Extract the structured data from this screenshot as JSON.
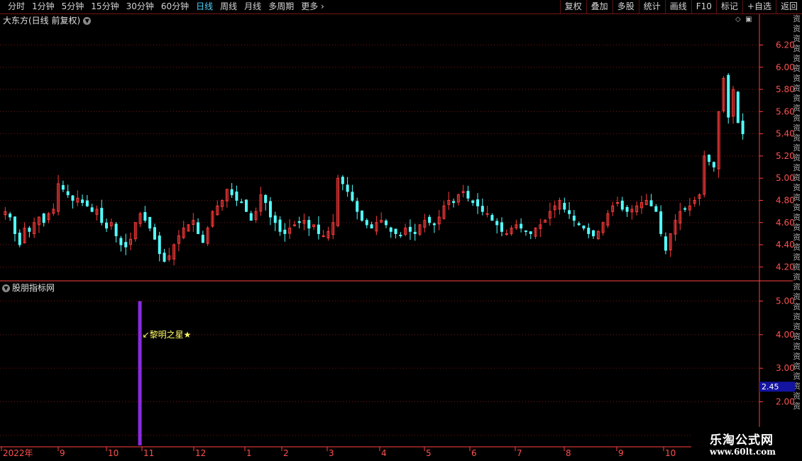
{
  "toolbar": {
    "periods": [
      {
        "label": "分时",
        "active": false
      },
      {
        "label": "1分钟",
        "active": false
      },
      {
        "label": "5分钟",
        "active": false
      },
      {
        "label": "15分钟",
        "active": false
      },
      {
        "label": "30分钟",
        "active": false
      },
      {
        "label": "60分钟",
        "active": false
      },
      {
        "label": "日线",
        "active": true
      },
      {
        "label": "周线",
        "active": false
      },
      {
        "label": "月线",
        "active": false
      },
      {
        "label": "多周期",
        "active": false
      },
      {
        "label": "更多",
        "active": false
      }
    ],
    "tools": [
      "复权",
      "叠加",
      "多股",
      "统计",
      "画线",
      "F10",
      "标记",
      "+自选",
      "返回"
    ]
  },
  "chart": {
    "title": "大东方(日线 前复权)",
    "indicator_title": "股朋指标网",
    "signal_label": "黎明之星",
    "current_value_tag": "2.45",
    "watermark_name": "乐淘公式网",
    "watermark_url": "www.60lt.com",
    "side_text": "资资资资资资资资资资资资资资资资资资资资资资资资资资资资资资资资资资资资资资资资",
    "colors": {
      "up": "#ff3b3b",
      "down": "#54ffff",
      "grid": "#7a1414",
      "axis": "#ff4040",
      "signal": "#8a2be2",
      "label": "#ffff66",
      "tag": "#1414a0"
    }
  },
  "chart_data": [
    {
      "type": "candlestick",
      "title": "大东方(日线 前复权)",
      "y_ticks": [
        6.2,
        6.0,
        5.8,
        5.6,
        5.4,
        5.2,
        5.0,
        4.8,
        4.6,
        4.4,
        4.2
      ],
      "ylim": [
        4.1,
        6.35
      ],
      "x_ticks": [
        "2022年",
        "9",
        "10",
        "11",
        "12",
        "1",
        "2",
        "3",
        "4",
        "5",
        "6",
        "7",
        "8",
        "9",
        "10"
      ],
      "close_series": [
        4.7,
        4.65,
        4.5,
        4.4,
        4.55,
        4.52,
        4.6,
        4.65,
        4.6,
        4.68,
        4.72,
        4.95,
        4.9,
        4.85,
        4.8,
        4.82,
        4.78,
        4.75,
        4.7,
        4.72,
        4.6,
        4.55,
        4.6,
        4.48,
        4.4,
        4.38,
        4.45,
        4.6,
        4.68,
        4.62,
        4.55,
        4.45,
        4.32,
        4.25,
        4.3,
        4.4,
        4.48,
        4.55,
        4.58,
        4.62,
        4.5,
        4.42,
        4.55,
        4.7,
        4.75,
        4.8,
        4.9,
        4.85,
        4.8,
        4.78,
        4.7,
        4.62,
        4.7,
        4.85,
        4.78,
        4.65,
        4.6,
        4.52,
        4.5,
        4.55,
        4.58,
        4.6,
        4.62,
        4.55,
        4.58,
        4.5,
        4.48,
        4.52,
        4.6,
        5.0,
        4.95,
        4.88,
        4.8,
        4.7,
        4.62,
        4.58,
        4.55,
        4.6,
        4.62,
        4.58,
        4.52,
        4.5,
        4.48,
        4.55,
        4.52,
        4.5,
        4.58,
        4.62,
        4.6,
        4.58,
        4.65,
        4.75,
        4.8,
        4.78,
        4.85,
        4.88,
        4.82,
        4.78,
        4.75,
        4.7,
        4.68,
        4.62,
        4.58,
        4.52,
        4.5,
        4.55,
        4.58,
        4.55,
        4.52,
        4.5,
        4.55,
        4.58,
        4.62,
        4.7,
        4.75,
        4.8,
        4.72,
        4.68,
        4.62,
        4.58,
        4.55,
        4.5,
        4.48,
        4.52,
        4.6,
        4.68,
        4.75,
        4.78,
        4.72,
        4.7,
        4.72,
        4.75,
        4.78,
        4.8,
        4.75,
        4.7,
        4.5,
        4.35,
        4.5,
        4.62,
        4.7,
        4.72,
        4.75,
        4.8,
        4.85,
        5.2,
        5.15,
        5.1,
        5.6,
        5.9,
        5.55,
        5.8,
        5.5,
        5.4
      ]
    },
    {
      "type": "bar",
      "title": "股朋指标网",
      "y_ticks": [
        5.0,
        4.0,
        3.0,
        2.0,
        1.0
      ],
      "ylim": [
        0.7,
        5.35
      ],
      "bars": [
        {
          "x_index": 28,
          "value": 5.0,
          "label": "黎明之星"
        }
      ],
      "current_value": 2.45
    }
  ]
}
